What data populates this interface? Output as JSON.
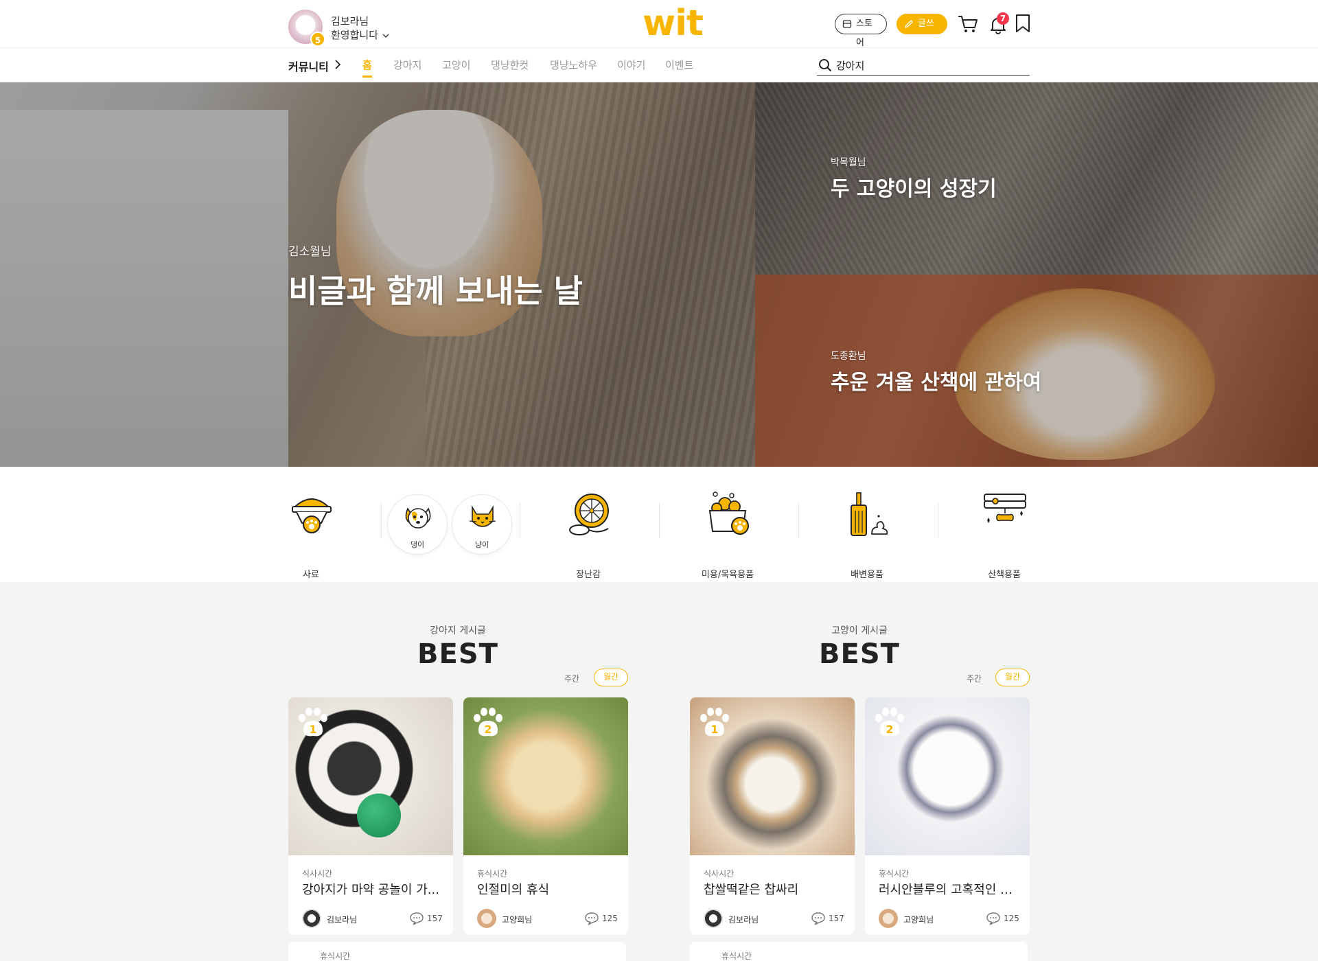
{
  "header": {
    "user_name": "김보라님",
    "welcome": "환영합니다",
    "user_level": "5",
    "logo": "wit",
    "store_label": "스토어",
    "write_label": "글쓰기",
    "notification_count": "7",
    "icons": [
      "store-icon",
      "pencil-icon",
      "cart-icon",
      "bell-icon",
      "bookmark-icon"
    ]
  },
  "nav": {
    "category": "커뮤니티",
    "tabs": [
      {
        "label": "홈",
        "active": true
      },
      {
        "label": "강아지"
      },
      {
        "label": "고양이"
      },
      {
        "label": "댕냥한컷"
      },
      {
        "label": "댕냥노하우"
      },
      {
        "label": "이야기"
      },
      {
        "label": "이벤트"
      }
    ],
    "search_value": "강아지"
  },
  "hero": {
    "main": {
      "author": "김소월님",
      "title": "비글과 함께 보내는 날"
    },
    "top": {
      "author": "박목월님",
      "title": "두 고양이의 성장기"
    },
    "bottom": {
      "author": "도종환님",
      "title": "추운 겨울 산책에 관하여"
    }
  },
  "categories": [
    {
      "label": "사료",
      "icon": "food-bowl-icon"
    },
    {
      "label": "댕이",
      "icon": "dog-face-icon"
    },
    {
      "label": "냥이",
      "icon": "cat-face-icon"
    },
    {
      "label": "장난감",
      "icon": "toy-wheel-icon"
    },
    {
      "label": "미용/목욕용품",
      "icon": "bath-tub-icon"
    },
    {
      "label": "배변용품",
      "icon": "litter-scoop-icon"
    },
    {
      "label": "산책용품",
      "icon": "collar-icon"
    }
  ],
  "best": [
    {
      "subtitle": "강아지 게시글",
      "title": "BEST",
      "periods": [
        "주간",
        "월간"
      ],
      "active_period": "월간",
      "cards": [
        {
          "rank": "1",
          "category": "식사시간",
          "title": "강아지가 마약 공놀이 가...",
          "author": "김보라님",
          "comments": "157"
        },
        {
          "rank": "2",
          "category": "휴식시간",
          "title": "인절미의 휴식",
          "author": "고양희님",
          "comments": "125"
        }
      ],
      "next_category": "휴식시간"
    },
    {
      "subtitle": "고양이 게시글",
      "title": "BEST",
      "periods": [
        "주간",
        "월간"
      ],
      "active_period": "월간",
      "cards": [
        {
          "rank": "1",
          "category": "식사시간",
          "title": "찹쌀떡같은 찹싸리",
          "author": "김보라님",
          "comments": "157"
        },
        {
          "rank": "2",
          "category": "휴식시간",
          "title": "러시안블루의 고혹적인 모습",
          "author": "고양희님",
          "comments": "125"
        }
      ],
      "next_category": "휴식시간"
    }
  ],
  "colors": {
    "accent": "#f7b500",
    "badge": "#f4364c",
    "section_bg": "#f4f4f4"
  }
}
